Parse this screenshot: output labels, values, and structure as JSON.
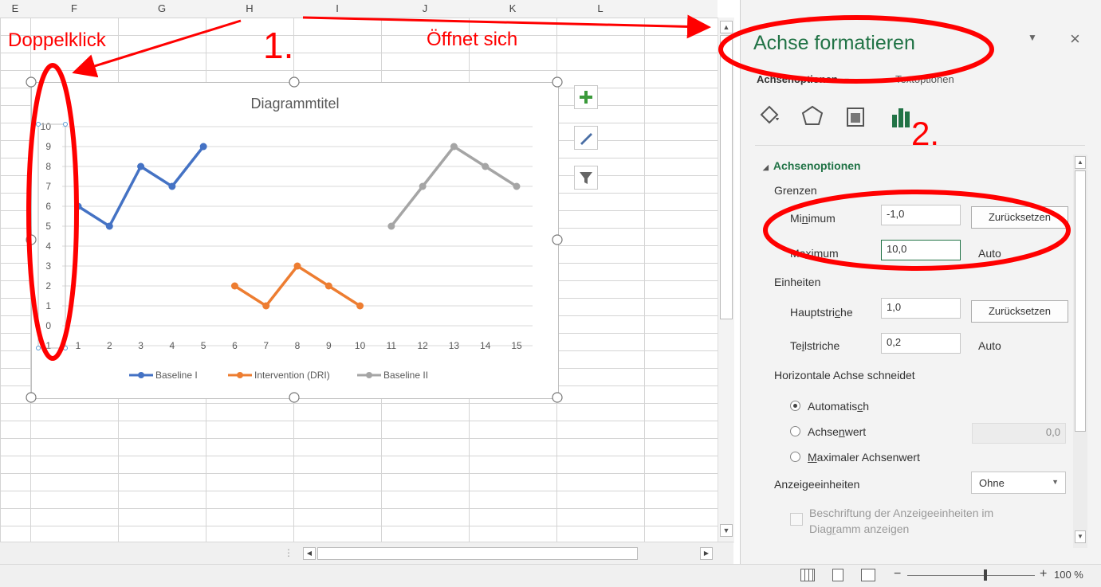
{
  "columns": [
    "E",
    "F",
    "G",
    "H",
    "I",
    "J",
    "K",
    "L"
  ],
  "chart": {
    "title": "Diagrammtitel",
    "y_ticks": [
      "10",
      "9",
      "8",
      "7",
      "6",
      "5",
      "4",
      "3",
      "2",
      "1",
      "0",
      "-1"
    ],
    "x_ticks": [
      "1",
      "2",
      "3",
      "4",
      "5",
      "6",
      "7",
      "8",
      "9",
      "10",
      "11",
      "12",
      "13",
      "14",
      "15"
    ],
    "legend": [
      "Baseline I",
      "Intervention (DRI)",
      "Baseline II"
    ],
    "tool_icons": [
      "plus-icon",
      "brush-icon",
      "filter-icon"
    ]
  },
  "chart_data": {
    "type": "line",
    "title": "Diagrammtitel",
    "x": [
      1,
      2,
      3,
      4,
      5,
      6,
      7,
      8,
      9,
      10,
      11,
      12,
      13,
      14,
      15
    ],
    "ylim": [
      -1,
      10
    ],
    "grid": true,
    "legend_position": "bottom",
    "series": [
      {
        "name": "Baseline I",
        "x": [
          1,
          2,
          3,
          4,
          5
        ],
        "values": [
          6,
          5,
          8,
          7,
          9
        ],
        "color": "#4472c4"
      },
      {
        "name": "Intervention (DRI)",
        "x": [
          6,
          7,
          8,
          9,
          10
        ],
        "values": [
          2,
          1,
          3,
          2,
          1
        ],
        "color": "#ed7d31"
      },
      {
        "name": "Baseline II",
        "x": [
          11,
          12,
          13,
          14,
          15
        ],
        "values": [
          5,
          7,
          9,
          8,
          7
        ],
        "color": "#a5a5a5"
      }
    ]
  },
  "annotations": {
    "doppelklick": "Doppelklick",
    "step1": "1.",
    "oeffnet": "Öffnet sich",
    "step2": "2.",
    "color": "#ff0000"
  },
  "pane": {
    "title": "Achse formatieren",
    "tab_axis": "Achsenoptionen",
    "tab_text": "Textoptionen",
    "icons": [
      "fill-line-icon",
      "effects-icon",
      "size-properties-icon",
      "axis-options-icon"
    ],
    "section": "Achsenoptionen",
    "grenzen": "Grenzen",
    "minimum_label": "Minimum",
    "minimum_value": "-1,0",
    "minimum_button": "Zurücksetzen",
    "maximum_label": "Maximum",
    "maximum_value": "10,0",
    "maximum_state": "Auto",
    "einheiten": "Einheiten",
    "haupt_label": "Hauptstriche",
    "haupt_value": "1,0",
    "haupt_button": "Zurücksetzen",
    "teil_label": "Teilstriche",
    "teil_value": "0,2",
    "teil_state": "Auto",
    "cross_heading": "Horizontale Achse schneidet",
    "radio_auto": "Automatisch",
    "radio_wert": "Achsenwert",
    "radio_wert_value": "0,0",
    "radio_max": "Maximaler Achsenwert",
    "display_units_label": "Anzeigeeinheiten",
    "display_units_value": "Ohne",
    "checkbox_line1": "Beschriftung der Anzeigeeinheiten im",
    "checkbox_line2": "Diagramm anzeigen",
    "accent": "#217346"
  },
  "status": {
    "zoom": "100 %"
  }
}
